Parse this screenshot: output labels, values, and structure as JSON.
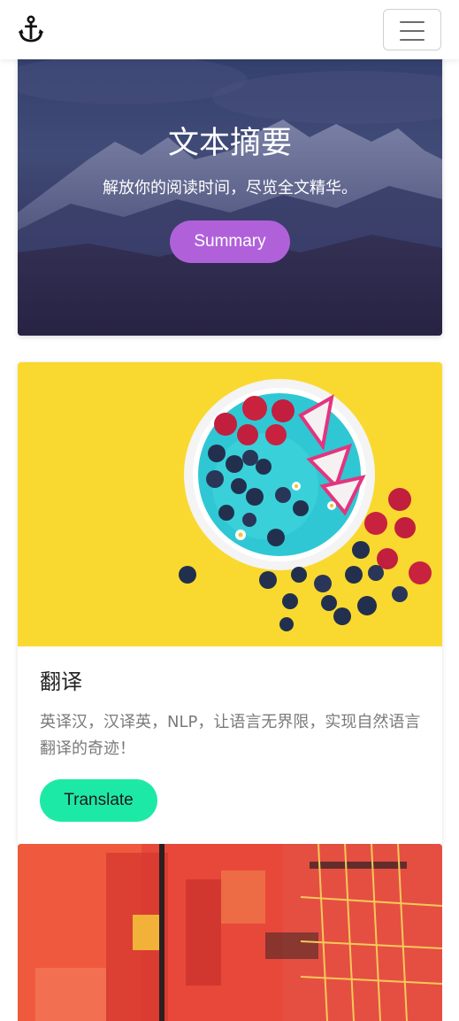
{
  "navbar": {
    "brand_icon": "anchor-icon",
    "menu_icon": "hamburger-menu-icon"
  },
  "hero": {
    "title": "文本摘要",
    "subtitle": "解放你的阅读时间，尽览全文精华。",
    "button_label": "Summary",
    "button_color": "#b061da"
  },
  "translate_card": {
    "title": "翻译",
    "description": "英译汉，汉译英，NLP，让语言无界限，实现自然语言翻译的奇迹！",
    "button_label": "Translate",
    "button_color": "#1de9a6",
    "image": "smoothie-bowl-image"
  },
  "third_card": {
    "image": "abstract-painting-image"
  }
}
